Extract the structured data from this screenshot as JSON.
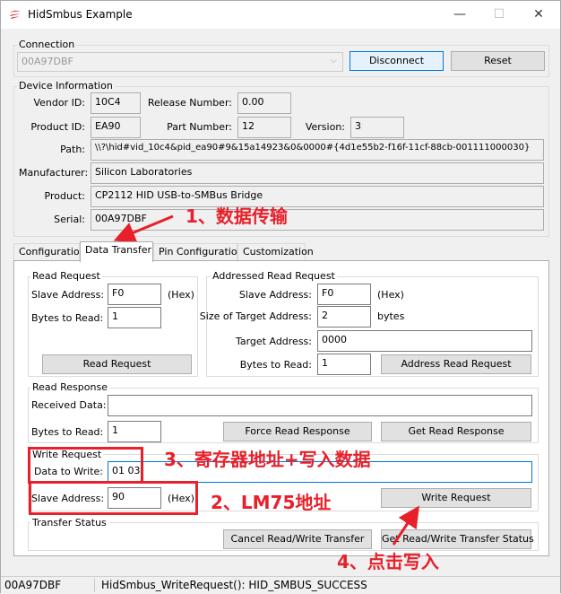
{
  "window": {
    "title": "HidSmbus Example",
    "minimize": "—",
    "maximize": "☐",
    "close": "✕"
  },
  "connection": {
    "group": "Connection",
    "device": "00A97DBF",
    "disconnect": "Disconnect",
    "reset": "Reset"
  },
  "device_info": {
    "group": "Device Information",
    "vendor_id_label": "Vendor ID:",
    "vendor_id": "10C4",
    "release_label": "Release Number:",
    "release": "0.00",
    "product_id_label": "Product ID:",
    "product_id": "EA90",
    "part_label": "Part Number:",
    "part": "12",
    "version_label": "Version:",
    "version": "3",
    "path_label": "Path:",
    "path": "\\\\?\\hid#vid_10c4&pid_ea90#9&15a14923&0&0000#{4d1e55b2-f16f-11cf-88cb-001111000030}",
    "manufacturer_label": "Manufacturer:",
    "manufacturer": "Silicon Laboratories",
    "product_label": "Product:",
    "product": "CP2112 HID USB-to-SMBus Bridge",
    "serial_label": "Serial:",
    "serial": "00A97DBF"
  },
  "tabs": [
    "Configuration",
    "Data Transfer",
    "Pin Configuration",
    "Customization"
  ],
  "read_request": {
    "group": "Read Request",
    "slave_label": "Slave Address:",
    "slave": "F0",
    "hex": "(Hex)",
    "bytes_label": "Bytes to Read:",
    "bytes": "1",
    "button": "Read Request"
  },
  "addressed_read": {
    "group": "Addressed Read Request",
    "slave_label": "Slave Address:",
    "slave": "F0",
    "hex": "(Hex)",
    "size_label": "Size of Target Address:",
    "size": "2",
    "size_unit": "bytes",
    "target_label": "Target Address:",
    "target": "0000",
    "bytes_label": "Bytes to Read:",
    "bytes": "1",
    "button": "Address Read Request"
  },
  "read_response": {
    "group": "Read Response",
    "received_label": "Received Data:",
    "received": "",
    "bytes_label": "Bytes to Read:",
    "bytes": "1",
    "force_button": "Force Read Response",
    "get_button": "Get Read Response"
  },
  "write_request": {
    "group": "Write Request",
    "data_label": "Data to Write:",
    "data": "01 03",
    "slave_label": "Slave Address:",
    "slave": "90",
    "hex": "(Hex)",
    "button": "Write Request"
  },
  "transfer_status": {
    "group": "Transfer Status",
    "cancel_button": "Cancel Read/Write Transfer",
    "get_button": "Get Read/Write Transfer Status"
  },
  "status_bar": {
    "device": "00A97DBF",
    "message": "HidSmbus_WriteRequest(): HID_SMBUS_SUCCESS"
  },
  "annotations": {
    "a1": "1、数据传输",
    "a2": "2、LM75地址",
    "a3": "3、寄存器地址+写入数据",
    "a4": "4、点击写入"
  },
  "colors": {
    "annotation": "#e8202a",
    "focus": "#0078d7"
  }
}
